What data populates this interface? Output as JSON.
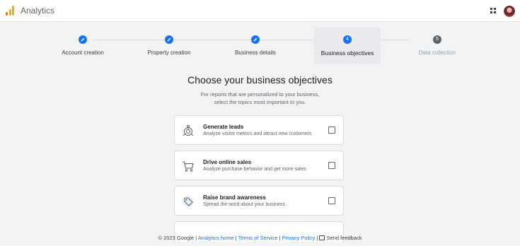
{
  "header": {
    "app_title": "Analytics",
    "logo_colors": [
      "#f9ab00",
      "#e37400",
      "#e37400"
    ],
    "apps_icon": "apps-grid-icon",
    "avatar": "user-avatar"
  },
  "stepper": {
    "steps": [
      {
        "label": "Account creation",
        "state": "done",
        "icon": "edit-pencil-icon"
      },
      {
        "label": "Property creation",
        "state": "done",
        "icon": "edit-pencil-icon"
      },
      {
        "label": "Business details",
        "state": "done",
        "icon": "edit-pencil-icon"
      },
      {
        "label": "Business objectives",
        "state": "active",
        "number": "4"
      },
      {
        "label": "Data collection",
        "state": "upcoming",
        "number": "5"
      }
    ],
    "accent_color": "#1a73e8"
  },
  "main": {
    "title": "Choose your business objectives",
    "subtitle_line1": "For reports that are personalized to your business,",
    "subtitle_line2": "select the topics most important to you.",
    "options": [
      {
        "title": "Generate leads",
        "description": "Analyze visitor metrics and attract new customers",
        "icon": "target-leads-icon",
        "checked": false
      },
      {
        "title": "Drive online sales",
        "description": "Analyze purchase behavior and get more sales",
        "icon": "shopping-cart-icon",
        "checked": false
      },
      {
        "title": "Raise brand awareness",
        "description": "Spread the word about your business",
        "icon": "price-tag-icon",
        "checked": false
      }
    ]
  },
  "footer": {
    "copyright": "© 2023 Google",
    "sep": "|",
    "analytics_home": "Analytics home",
    "terms": "Terms of Service",
    "privacy": "Privacy Policy",
    "feedback": "Send feedback"
  }
}
